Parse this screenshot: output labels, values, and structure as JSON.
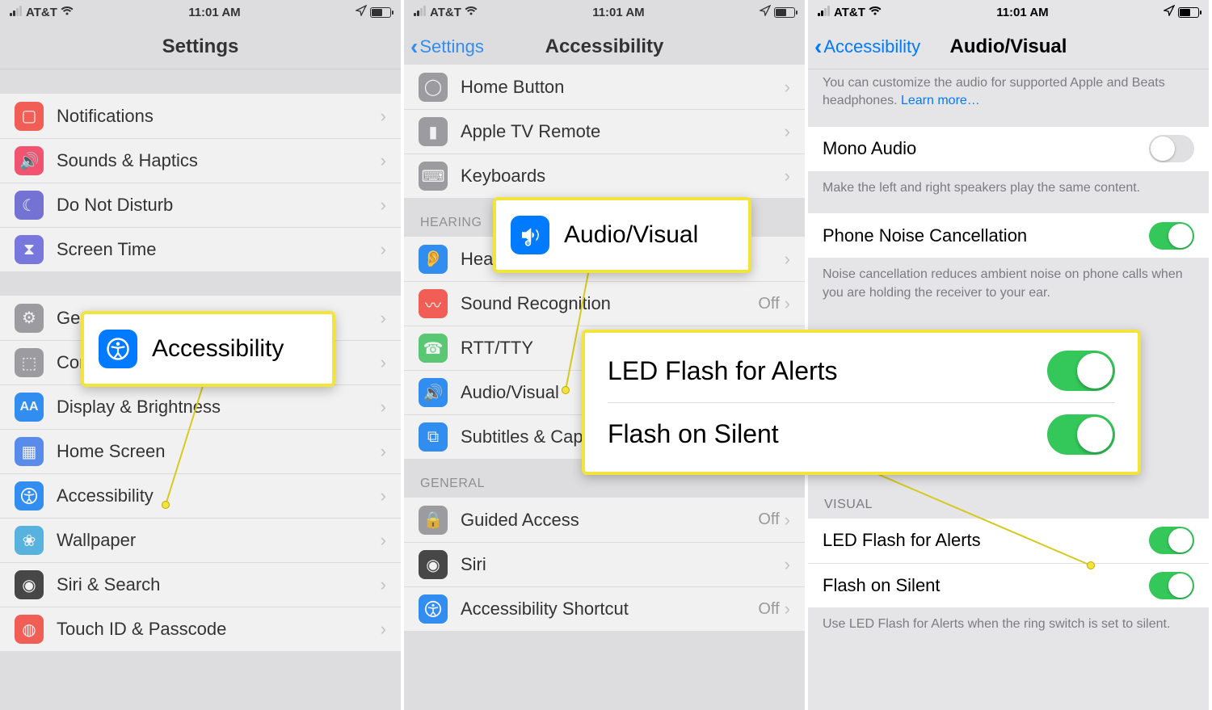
{
  "status": {
    "carrier": "AT&T",
    "time": "11:01 AM"
  },
  "panel1": {
    "title": "Settings",
    "groupA": [
      {
        "label": "Notifications"
      },
      {
        "label": "Sounds & Haptics"
      },
      {
        "label": "Do Not Disturb"
      },
      {
        "label": "Screen Time"
      }
    ],
    "groupB": [
      {
        "label": "General"
      },
      {
        "label": "Control Center"
      },
      {
        "label": "Display & Brightness"
      },
      {
        "label": "Home Screen"
      },
      {
        "label": "Accessibility"
      },
      {
        "label": "Wallpaper"
      },
      {
        "label": "Siri & Search"
      },
      {
        "label": "Touch ID & Passcode"
      }
    ],
    "callout_label": "Accessibility"
  },
  "panel2": {
    "back": "Settings",
    "title": "Accessibility",
    "top": [
      {
        "label": "Home Button"
      },
      {
        "label": "Apple TV Remote"
      },
      {
        "label": "Keyboards"
      }
    ],
    "hearing_header": "HEARING",
    "hearing": [
      {
        "label": "Hearing Devices"
      },
      {
        "label": "Sound Recognition",
        "value": "Off"
      },
      {
        "label": "RTT/TTY"
      },
      {
        "label": "Audio/Visual"
      },
      {
        "label": "Subtitles & Captioning"
      }
    ],
    "general_header": "GENERAL",
    "general": [
      {
        "label": "Guided Access",
        "value": "Off"
      },
      {
        "label": "Siri"
      },
      {
        "label": "Accessibility Shortcut",
        "value": "Off"
      }
    ],
    "callout_label": "Audio/Visual"
  },
  "panel3": {
    "back": "Accessibility",
    "title": "Audio/Visual",
    "desc_top": "You can customize the audio for supported Apple and Beats headphones. ",
    "desc_top_link": "Learn more…",
    "mono_label": "Mono Audio",
    "mono_footer": "Make the left and right speakers play the same content.",
    "pnc_label": "Phone Noise Cancellation",
    "pnc_footer": "Noise cancellation reduces ambient noise on phone calls when you are holding the receiver to your ear.",
    "visual_header": "VISUAL",
    "led_label": "LED Flash for Alerts",
    "fos_label": "Flash on Silent",
    "visual_footer": "Use LED Flash for Alerts when the ring switch is set to silent."
  }
}
